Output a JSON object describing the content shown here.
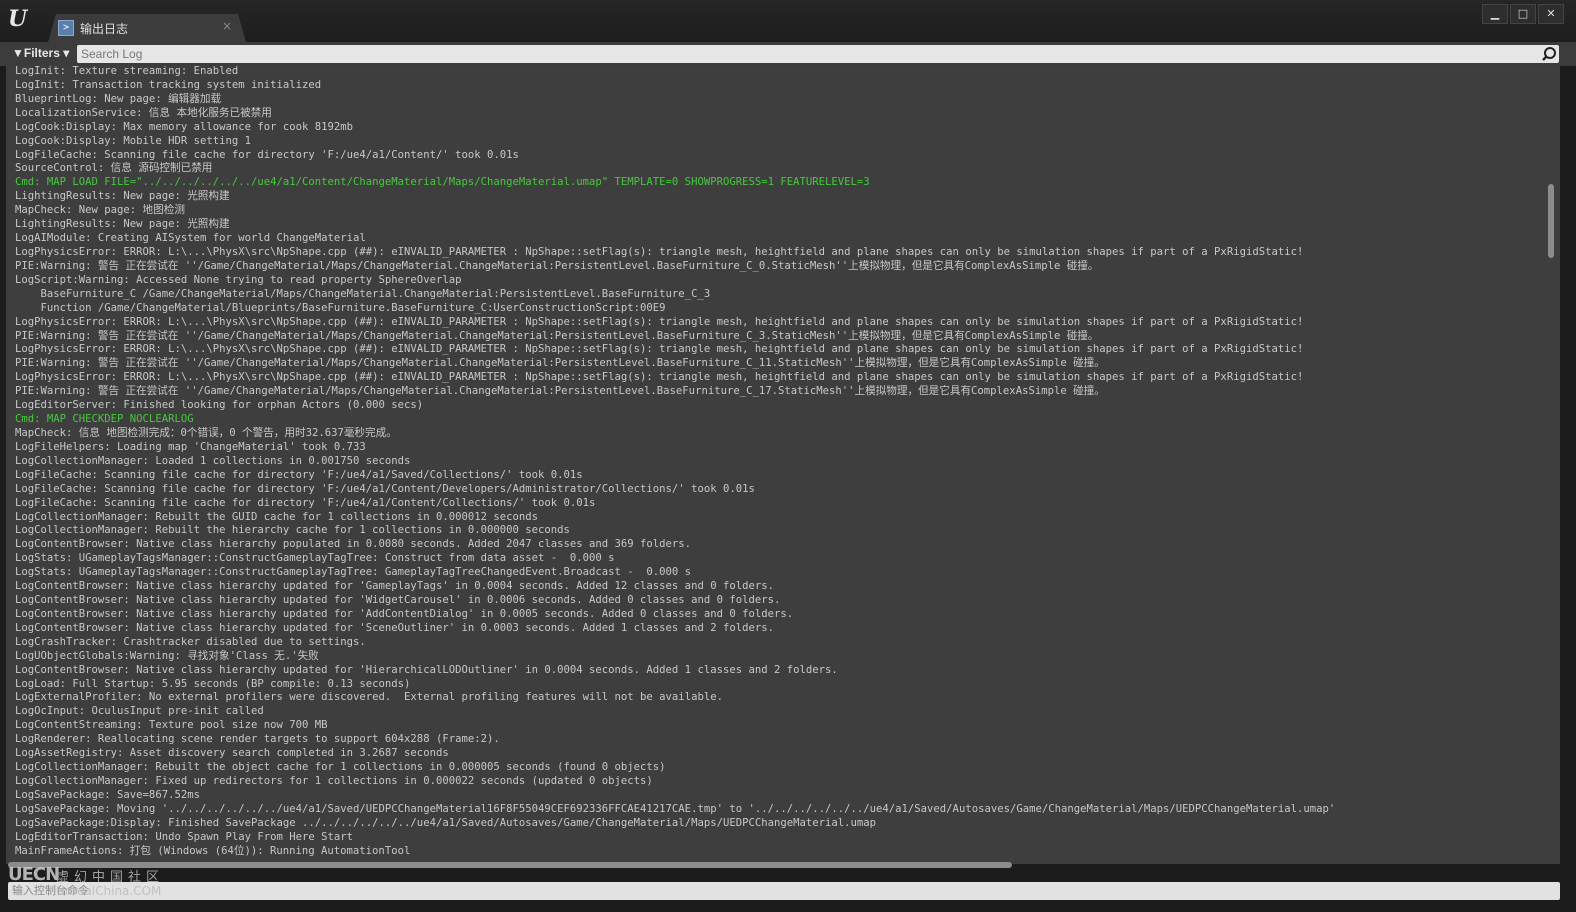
{
  "window": {
    "tab_title": "输出日志",
    "tab_icon": "output-log-icon",
    "tab_close": "×",
    "minimize": "▁",
    "maximize": "□",
    "close": "✕"
  },
  "toolbar": {
    "filters_label": "▼Filters ▾",
    "search_placeholder": "Search Log"
  },
  "console": {
    "placeholder": "输入控制台命令"
  },
  "watermark": {
    "logo": "UECN",
    "cn": "虚幻中国社区",
    "url": "UnrealChina.COM"
  },
  "colors": {
    "default": "#c8c8c8",
    "cmd": "#47c83e",
    "warning": "#d8d83a",
    "error": "#c82222"
  },
  "log": [
    {
      "t": "LogInit: Texture streaming: Enabled",
      "c": "default"
    },
    {
      "t": "LogInit: Transaction tracking system initialized",
      "c": "default"
    },
    {
      "t": "BlueprintLog: New page: 编辑器加载",
      "c": "default"
    },
    {
      "t": "LocalizationService: 信息 本地化服务已被禁用",
      "c": "default"
    },
    {
      "t": "LogCook:Display: Max memory allowance for cook 8192mb",
      "c": "default"
    },
    {
      "t": "LogCook:Display: Mobile HDR setting 1",
      "c": "default"
    },
    {
      "t": "LogFileCache: Scanning file cache for directory 'F:/ue4/a1/Content/' took 0.01s",
      "c": "default"
    },
    {
      "t": "SourceControl: 信息 源码控制已禁用",
      "c": "default"
    },
    {
      "t": "Cmd: MAP LOAD FILE=\"../../../../../../ue4/a1/Content/ChangeMaterial/Maps/ChangeMaterial.umap\" TEMPLATE=0 SHOWPROGRESS=1 FEATURELEVEL=3",
      "c": "cmd"
    },
    {
      "t": "LightingResults: New page: 光照构建",
      "c": "default"
    },
    {
      "t": "MapCheck: New page: 地图检测",
      "c": "default"
    },
    {
      "t": "LightingResults: New page: 光照构建",
      "c": "default"
    },
    {
      "t": "LogAIModule: Creating AISystem for world ChangeMaterial",
      "c": "default"
    },
    {
      "t": "LogPhysicsError: ERROR: L:\\...\\PhysX\\src\\NpShape.cpp (##): eINVALID_PARAMETER : NpShape::setFlag(s): triangle mesh, heightfield and plane shapes can only be simulation shapes if part of a PxRigidStatic!",
      "c": "error"
    },
    {
      "t": "PIE:Warning: 警告 正在尝试在 ''/Game/ChangeMaterial/Maps/ChangeMaterial.ChangeMaterial:PersistentLevel.BaseFurniture_C_0.StaticMesh''上模拟物理，但是它具有ComplexAsSimple 碰撞。",
      "c": "warning"
    },
    {
      "t": "LogScript:Warning: Accessed None trying to read property SphereOverlap",
      "c": "warning"
    },
    {
      "t": "    BaseFurniture_C /Game/ChangeMaterial/Maps/ChangeMaterial.ChangeMaterial:PersistentLevel.BaseFurniture_C_3",
      "c": "warning"
    },
    {
      "t": "    Function /Game/ChangeMaterial/Blueprints/BaseFurniture.BaseFurniture_C:UserConstructionScript:00E9",
      "c": "warning"
    },
    {
      "t": "LogPhysicsError: ERROR: L:\\...\\PhysX\\src\\NpShape.cpp (##): eINVALID_PARAMETER : NpShape::setFlag(s): triangle mesh, heightfield and plane shapes can only be simulation shapes if part of a PxRigidStatic!",
      "c": "error"
    },
    {
      "t": "PIE:Warning: 警告 正在尝试在 ''/Game/ChangeMaterial/Maps/ChangeMaterial.ChangeMaterial:PersistentLevel.BaseFurniture_C_3.StaticMesh''上模拟物理，但是它具有ComplexAsSimple 碰撞。",
      "c": "warning"
    },
    {
      "t": "LogPhysicsError: ERROR: L:\\...\\PhysX\\src\\NpShape.cpp (##): eINVALID_PARAMETER : NpShape::setFlag(s): triangle mesh, heightfield and plane shapes can only be simulation shapes if part of a PxRigidStatic!",
      "c": "error"
    },
    {
      "t": "PIE:Warning: 警告 正在尝试在 ''/Game/ChangeMaterial/Maps/ChangeMaterial.ChangeMaterial:PersistentLevel.BaseFurniture_C_11.StaticMesh''上模拟物理，但是它具有ComplexAsSimple 碰撞。",
      "c": "warning"
    },
    {
      "t": "LogPhysicsError: ERROR: L:\\...\\PhysX\\src\\NpShape.cpp (##): eINVALID_PARAMETER : NpShape::setFlag(s): triangle mesh, heightfield and plane shapes can only be simulation shapes if part of a PxRigidStatic!",
      "c": "error"
    },
    {
      "t": "PIE:Warning: 警告 正在尝试在 ''/Game/ChangeMaterial/Maps/ChangeMaterial.ChangeMaterial:PersistentLevel.BaseFurniture_C_17.StaticMesh''上模拟物理，但是它具有ComplexAsSimple 碰撞。",
      "c": "warning"
    },
    {
      "t": "LogEditorServer: Finished looking for orphan Actors (0.000 secs)",
      "c": "default"
    },
    {
      "t": "Cmd: MAP CHECKDEP NOCLEARLOG",
      "c": "cmd"
    },
    {
      "t": "MapCheck: 信息 地图检测完成：0个错误，0 个警告，用时32.637毫秒完成。",
      "c": "default"
    },
    {
      "t": "LogFileHelpers: Loading map 'ChangeMaterial' took 0.733",
      "c": "default"
    },
    {
      "t": "LogCollectionManager: Loaded 1 collections in 0.001750 seconds",
      "c": "default"
    },
    {
      "t": "LogFileCache: Scanning file cache for directory 'F:/ue4/a1/Saved/Collections/' took 0.01s",
      "c": "default"
    },
    {
      "t": "LogFileCache: Scanning file cache for directory 'F:/ue4/a1/Content/Developers/Administrator/Collections/' took 0.01s",
      "c": "default"
    },
    {
      "t": "LogFileCache: Scanning file cache for directory 'F:/ue4/a1/Content/Collections/' took 0.01s",
      "c": "default"
    },
    {
      "t": "LogCollectionManager: Rebuilt the GUID cache for 1 collections in 0.000012 seconds",
      "c": "default"
    },
    {
      "t": "LogCollectionManager: Rebuilt the hierarchy cache for 1 collections in 0.000000 seconds",
      "c": "default"
    },
    {
      "t": "LogContentBrowser: Native class hierarchy populated in 0.0080 seconds. Added 2047 classes and 369 folders.",
      "c": "default"
    },
    {
      "t": "LogStats: UGameplayTagsManager::ConstructGameplayTagTree: Construct from data asset -  0.000 s",
      "c": "default"
    },
    {
      "t": "LogStats: UGameplayTagsManager::ConstructGameplayTagTree: GameplayTagTreeChangedEvent.Broadcast -  0.000 s",
      "c": "default"
    },
    {
      "t": "LogContentBrowser: Native class hierarchy updated for 'GameplayTags' in 0.0004 seconds. Added 12 classes and 0 folders.",
      "c": "default"
    },
    {
      "t": "LogContentBrowser: Native class hierarchy updated for 'WidgetCarousel' in 0.0006 seconds. Added 0 classes and 0 folders.",
      "c": "default"
    },
    {
      "t": "LogContentBrowser: Native class hierarchy updated for 'AddContentDialog' in 0.0005 seconds. Added 0 classes and 0 folders.",
      "c": "default"
    },
    {
      "t": "LogContentBrowser: Native class hierarchy updated for 'SceneOutliner' in 0.0003 seconds. Added 1 classes and 2 folders.",
      "c": "default"
    },
    {
      "t": "LogCrashTracker: Crashtracker disabled due to settings.",
      "c": "default"
    },
    {
      "t": "LogUObjectGlobals:Warning: 寻找对象'Class 无.'失败",
      "c": "warning"
    },
    {
      "t": "LogContentBrowser: Native class hierarchy updated for 'HierarchicalLODOutliner' in 0.0004 seconds. Added 1 classes and 2 folders.",
      "c": "default"
    },
    {
      "t": "LogLoad: Full Startup: 5.95 seconds (BP compile: 0.13 seconds)",
      "c": "default"
    },
    {
      "t": "LogExternalProfiler: No external profilers were discovered.  External profiling features will not be available.",
      "c": "default"
    },
    {
      "t": "LogOcInput: OculusInput pre-init called",
      "c": "default"
    },
    {
      "t": "LogContentStreaming: Texture pool size now 700 MB",
      "c": "default"
    },
    {
      "t": "LogRenderer: Reallocating scene render targets to support 604x288 (Frame:2).",
      "c": "default"
    },
    {
      "t": "LogAssetRegistry: Asset discovery search completed in 3.2687 seconds",
      "c": "default"
    },
    {
      "t": "LogCollectionManager: Rebuilt the object cache for 1 collections in 0.000005 seconds (found 0 objects)",
      "c": "default"
    },
    {
      "t": "LogCollectionManager: Fixed up redirectors for 1 collections in 0.000022 seconds (updated 0 objects)",
      "c": "default"
    },
    {
      "t": "LogSavePackage: Save=867.52ms",
      "c": "default"
    },
    {
      "t": "LogSavePackage: Moving '../../../../../../ue4/a1/Saved/UEDPCChangeMaterial16F8F55049CEF692336FFCAE41217CAE.tmp' to '../../../../../../ue4/a1/Saved/Autosaves/Game/ChangeMaterial/Maps/UEDPCChangeMaterial.umap'",
      "c": "default"
    },
    {
      "t": "LogSavePackage:Display: Finished SavePackage ../../../../../../ue4/a1/Saved/Autosaves/Game/ChangeMaterial/Maps/UEDPCChangeMaterial.umap",
      "c": "default"
    },
    {
      "t": "LogEditorTransaction: Undo Spawn Play From Here Start",
      "c": "default"
    },
    {
      "t": "MainFrameActions: 打包 (Windows (64位)): Running AutomationTool",
      "c": "default"
    }
  ]
}
